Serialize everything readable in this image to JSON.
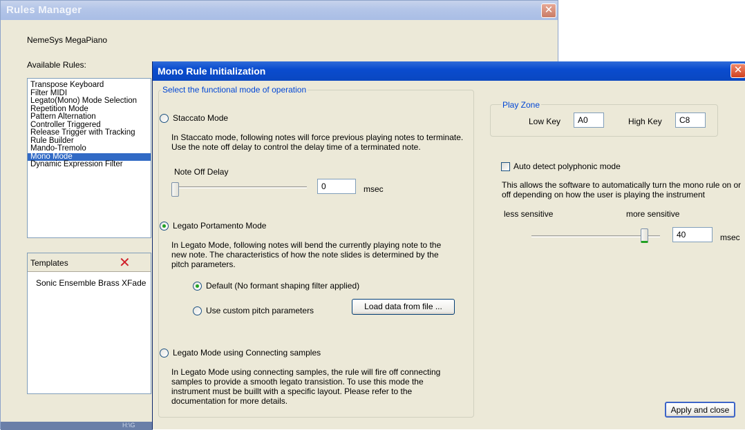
{
  "rules_manager": {
    "title": "Rules Manager",
    "close_label": "✕",
    "product": "NemeSys MegaPiano",
    "available_rules_label": "Available Rules:",
    "rules": [
      "Transpose Keyboard",
      "Filter MIDI",
      "Legato(Mono) Mode Selection",
      "Repetition Mode",
      "Pattern Alternation",
      "Controller Triggered",
      "Release Trigger with Tracking",
      "Rule Builder",
      "Mando-Tremolo",
      "Mono Mode",
      "Dynamic Expression Filter"
    ],
    "selected_rule": "Mono Mode",
    "templates_label": "Templates",
    "templates_delete_icon": "✕",
    "templates": [
      "Sonic Ensemble Brass XFade"
    ],
    "status_fragment": "H:\\G"
  },
  "dialog": {
    "title": "Mono Rule Initialization",
    "close_label": "✕",
    "group_caption": "Select the functional mode of operation",
    "staccato": {
      "label": "Staccato Mode",
      "checked": false,
      "description": "In Staccato mode, following notes will force previous playing notes to terminate. Use the note off delay to control the delay time of a terminated note.",
      "delay_label": "Note Off Delay",
      "delay_value": "0",
      "delay_unit": "msec",
      "slider_level": 0
    },
    "legato_portamento": {
      "label": "Legato Portamento Mode",
      "checked": true,
      "description": "In Legato Mode, following notes will bend the currently playing note to the new note. The characteristics of how the note slides is determined by the pitch parameters.",
      "default_option": "Default (No formant shaping filter applied)",
      "default_checked": true,
      "custom_option": "Use custom pitch parameters",
      "custom_checked": false,
      "load_button": "Load data from file ..."
    },
    "legato_connecting": {
      "label": "Legato Mode using Connecting samples",
      "checked": false,
      "description": "In Legato Mode using connecting samples, the rule will fire off connecting samples to provide a smooth legato transistion. To use this mode the instrument must be buillt with a specific layout. Please refer to the documentation for more details."
    },
    "play_zone": {
      "caption": "Play Zone",
      "low_key_label": "Low Key",
      "low_key_value": "A0",
      "high_key_label": "High Key",
      "high_key_value": "C8"
    },
    "auto_detect": {
      "label": "Auto detect polyphonic mode",
      "checked": false,
      "description": "This allows the software to automatically turn the mono rule on or off depending on how the user is playing the instrument",
      "less_label": "less sensitive",
      "more_label": "more sensitive",
      "value": "40",
      "unit": "msec",
      "slider_level": 0.9
    },
    "apply_button": "Apply and close"
  }
}
